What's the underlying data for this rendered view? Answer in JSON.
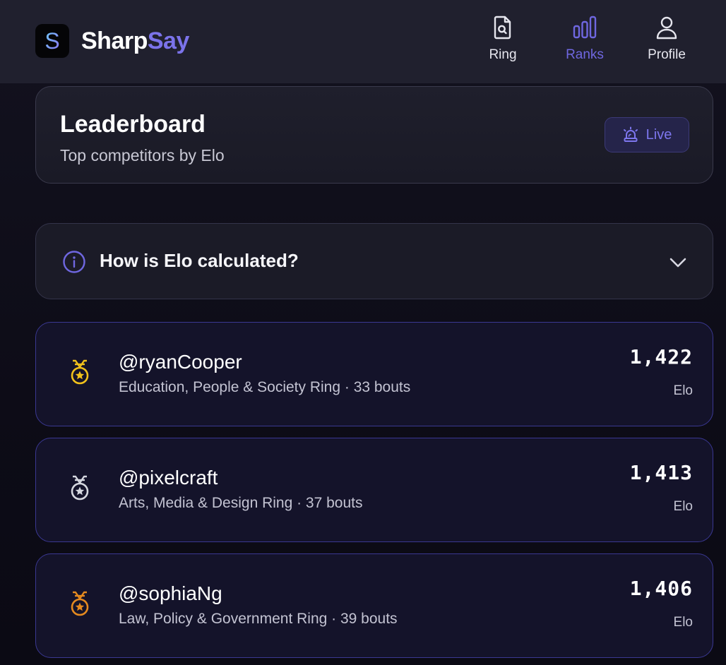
{
  "app": {
    "brand_part1": "Sharp",
    "brand_part2": "Say",
    "logo_letter": "S",
    "colors": {
      "accent": "#7b73ea",
      "gold": "#f2c21b",
      "silver": "#d6d8e0",
      "bronze": "#e58a1f"
    }
  },
  "nav": [
    {
      "label": "Ring",
      "icon": "document-search-icon",
      "active": false
    },
    {
      "label": "Ranks",
      "icon": "bar-chart-icon",
      "active": true
    },
    {
      "label": "Profile",
      "icon": "user-icon",
      "active": false
    }
  ],
  "leaderboard": {
    "title": "Leaderboard",
    "subtitle": "Top competitors by Elo",
    "live_label": "Live",
    "live_icon": "siren-icon"
  },
  "faq": {
    "question": "How is Elo calculated?",
    "icon": "info-icon",
    "toggle_icon": "chevron-down-icon"
  },
  "rankings": [
    {
      "handle": "@ryanCooper",
      "meta": "Education, People & Society Ring · 33 bouts",
      "elo": "1,422",
      "unit": "Elo",
      "medal": "gold-medal-icon"
    },
    {
      "handle": "@pixelcraft",
      "meta": "Arts, Media & Design Ring · 37 bouts",
      "elo": "1,413",
      "unit": "Elo",
      "medal": "silver-medal-icon"
    },
    {
      "handle": "@sophiaNg",
      "meta": "Law, Policy & Government Ring · 39 bouts",
      "elo": "1,406",
      "unit": "Elo",
      "medal": "bronze-medal-icon"
    }
  ]
}
